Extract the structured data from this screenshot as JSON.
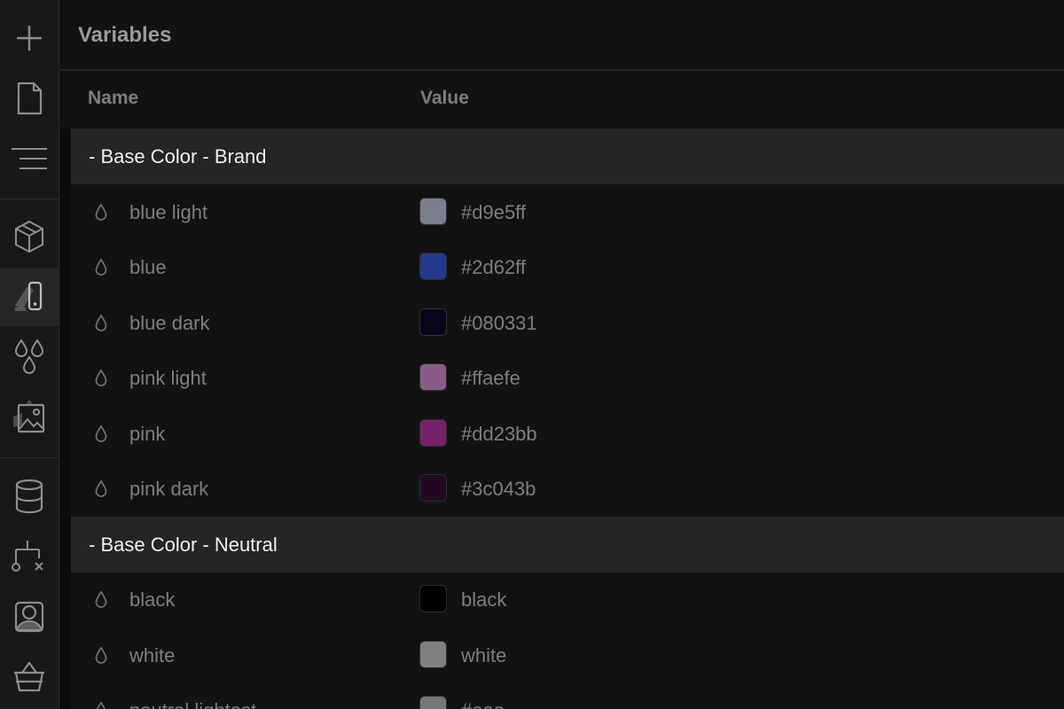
{
  "sidebar": {
    "items": [
      {
        "icon": "plus-icon"
      },
      {
        "icon": "page-icon"
      },
      {
        "icon": "navigator-icon"
      },
      {
        "icon": "cube-icon"
      },
      {
        "icon": "style-swatch-icon",
        "active": true
      },
      {
        "icon": "variables-drops-icon"
      },
      {
        "icon": "assets-image-icon"
      },
      {
        "icon": "database-icon"
      },
      {
        "icon": "logic-flow-icon"
      },
      {
        "icon": "user-icon"
      },
      {
        "icon": "basket-icon"
      }
    ]
  },
  "panel": {
    "title": "Variables"
  },
  "columns": {
    "name": "Name",
    "value": "Value"
  },
  "groups": [
    {
      "label": "- Base Color - Brand",
      "variables": [
        {
          "name": "blue light",
          "value": "#d9e5ff",
          "swatch": "#7a7f8c"
        },
        {
          "name": "blue",
          "value": "#2d62ff",
          "swatch": "#22398e"
        },
        {
          "name": "blue dark",
          "value": "#080331",
          "swatch": "#07041c"
        },
        {
          "name": "pink light",
          "value": "#ffaefe",
          "swatch": "#8a5d89"
        },
        {
          "name": "pink",
          "value": "#dd23bb",
          "swatch": "#76226a"
        },
        {
          "name": "pink dark",
          "value": "#3c043b",
          "swatch": "#220822"
        }
      ]
    },
    {
      "label": "- Base Color - Neutral",
      "variables": [
        {
          "name": "black",
          "value": "black",
          "swatch": "#000000"
        },
        {
          "name": "white",
          "value": "white",
          "swatch": "#808080"
        },
        {
          "name": "neutral lightest",
          "value": "#eee",
          "swatch": "#777777"
        }
      ]
    }
  ]
}
